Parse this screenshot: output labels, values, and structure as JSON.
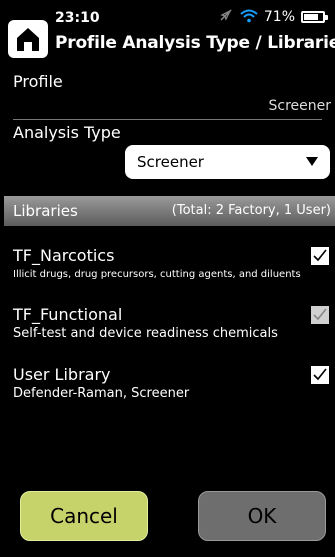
{
  "status_bar": {
    "time": "23:10",
    "battery_percent": "71%",
    "icons": [
      "no-location-icon",
      "wifi-icon",
      "battery-icon"
    ]
  },
  "header": {
    "home_icon": "home-icon",
    "title": "Profile Analysis Type / Libraries"
  },
  "profile": {
    "label": "Profile",
    "value": "Screener"
  },
  "analysis_type": {
    "label": "Analysis Type",
    "selected": "Screener"
  },
  "libraries": {
    "header": "Libraries",
    "total": "(Total: 2 Factory, 1 User)",
    "items": [
      {
        "name": "TF_Narcotics",
        "description": "Illicit drugs, drug precursors, cutting agents, and diluents",
        "checked": true,
        "enabled": true
      },
      {
        "name": "TF_Functional",
        "description": "Self-test and device readiness chemicals",
        "checked": true,
        "enabled": false
      },
      {
        "name": "User Library",
        "description": "Defender-Raman, Screener",
        "checked": true,
        "enabled": true
      }
    ]
  },
  "buttons": {
    "cancel": "Cancel",
    "ok": "OK"
  },
  "colors": {
    "background": "#000000",
    "cancel_button": "#c6d36a",
    "ok_button": "#6e6e6e",
    "section_bar": "#7a7a7a"
  }
}
